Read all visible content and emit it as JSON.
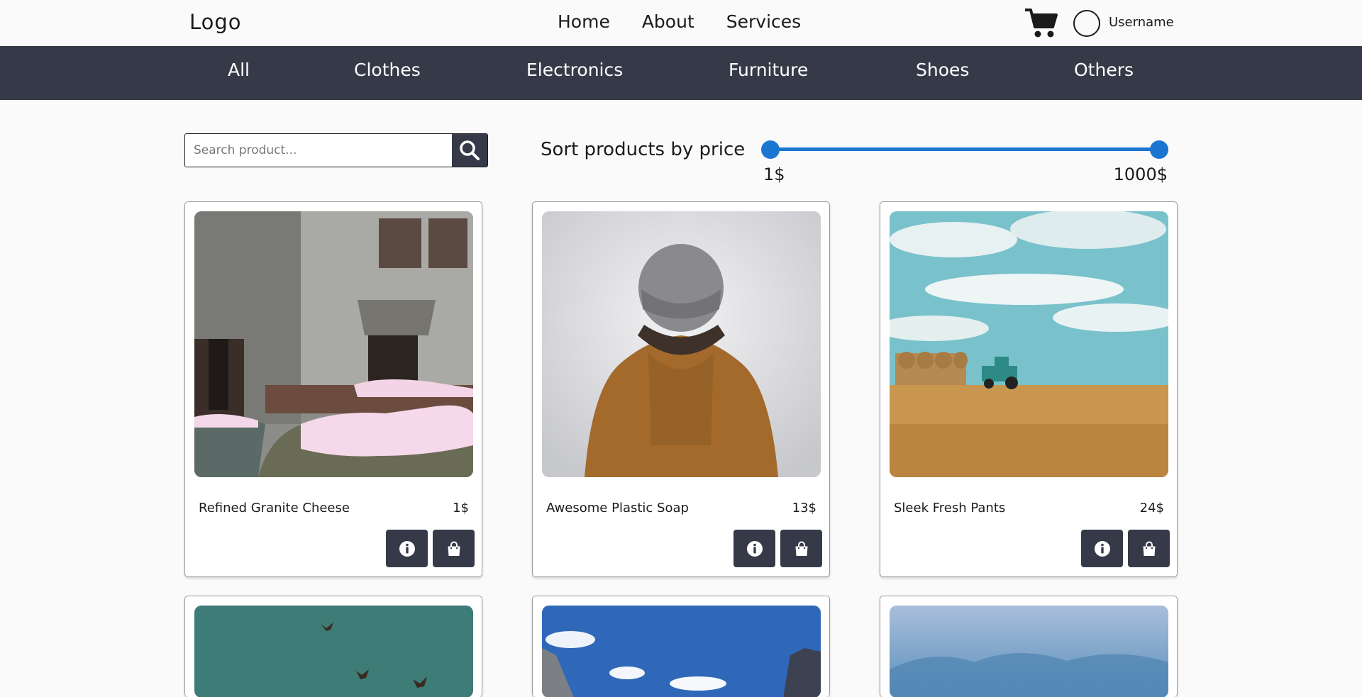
{
  "header": {
    "logo": "Logo",
    "nav": [
      "Home",
      "About",
      "Services"
    ],
    "cart_icon": "cart-icon",
    "avatar_icon": "avatar",
    "username": "Username"
  },
  "categories": [
    "All",
    "Clothes",
    "Electronics",
    "Furniture",
    "Shoes",
    "Others"
  ],
  "search": {
    "placeholder": "Search product...",
    "icon": "search-icon"
  },
  "price_filter": {
    "label": "Sort products by price",
    "min_label": "1$",
    "max_label": "1000$",
    "accent_color": "#1b76d2"
  },
  "products": [
    {
      "name": "Refined Granite Cheese",
      "price": "1$",
      "image": "snowy-cars-old-building"
    },
    {
      "name": "Awesome Plastic Soap",
      "price": "13$",
      "image": "person-in-beanie-and-jacket"
    },
    {
      "name": "Sleek Fresh Pants",
      "price": "24$",
      "image": "tractor-in-field"
    },
    {
      "name": "",
      "price": "",
      "image": "birds-in-sky"
    },
    {
      "name": "",
      "price": "",
      "image": "mountains-blue-sky"
    },
    {
      "name": "",
      "price": "",
      "image": "misty-forest"
    }
  ],
  "colors": {
    "dark": "#363a48",
    "background": "#fafafa",
    "accent": "#1b76d2"
  }
}
